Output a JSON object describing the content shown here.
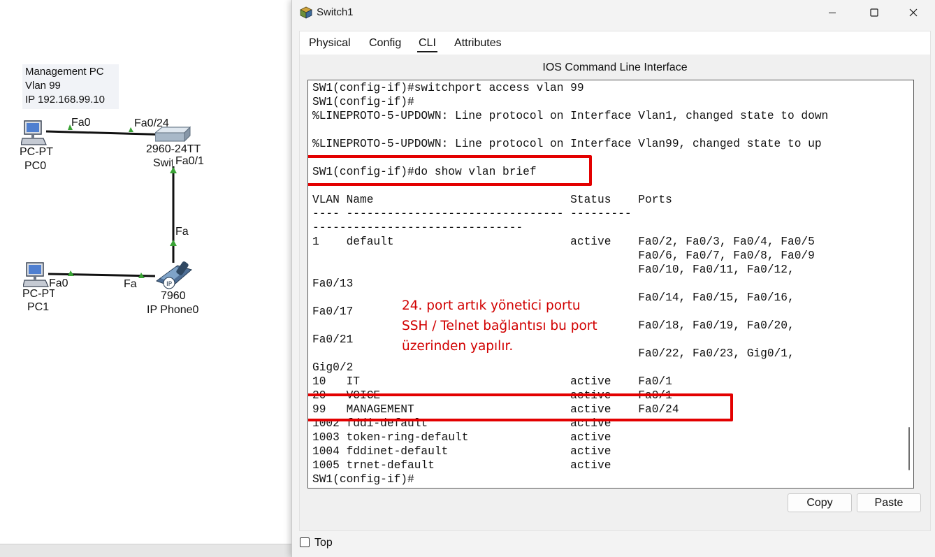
{
  "topology": {
    "note_lines": [
      "Management PC",
      "Vlan 99",
      "IP 192.168.99.10"
    ],
    "pc0": {
      "model": "PC-PT",
      "name": "PC0"
    },
    "pc1": {
      "model": "PC-PT",
      "name": "PC1"
    },
    "switch": {
      "model": "2960-24TT",
      "name": "Switch1"
    },
    "phone": {
      "model": "7960",
      "name": "IP Phone0"
    },
    "port_labels": {
      "pc0_port": "Fa0",
      "switch_fa024": "Fa0/24",
      "switch_fa01": "Fa0/1",
      "phone_up": "Fa",
      "pc1_port": "Fa0",
      "phone_left": "Fa"
    }
  },
  "window": {
    "title": "Switch1",
    "tabs": [
      "Physical",
      "Config",
      "CLI",
      "Attributes"
    ],
    "active_tab": "CLI",
    "cli_header": "IOS Command Line Interface",
    "cli_lines": [
      "SW1(config-if)#switchport access vlan 99",
      "SW1(config-if)#",
      "%LINEPROTO-5-UPDOWN: Line protocol on Interface Vlan1, changed state to down",
      "",
      "%LINEPROTO-5-UPDOWN: Line protocol on Interface Vlan99, changed state to up",
      "",
      "SW1(config-if)#do show vlan brief",
      "",
      "VLAN Name                             Status    Ports",
      "---- -------------------------------- ---------",
      "-------------------------------",
      "1    default                          active    Fa0/2, Fa0/3, Fa0/4, Fa0/5",
      "                                                Fa0/6, Fa0/7, Fa0/8, Fa0/9",
      "                                                Fa0/10, Fa0/11, Fa0/12,",
      "Fa0/13",
      "                                                Fa0/14, Fa0/15, Fa0/16,",
      "Fa0/17",
      "                                                Fa0/18, Fa0/19, Fa0/20,",
      "Fa0/21",
      "                                                Fa0/22, Fa0/23, Gig0/1,",
      "Gig0/2",
      "10   IT                               active    Fa0/1",
      "20   VOICE                            active    Fa0/1",
      "99   MANAGEMENT                       active    Fa0/24",
      "1002 fddi-default                     active",
      "1003 token-ring-default               active",
      "1004 fddinet-default                  active",
      "1005 trnet-default                    active",
      "SW1(config-if)#"
    ],
    "annotation_lines": [
      "24. port artık yönetici portu",
      "SSH / Telnet bağlantısı bu port",
      "üzerinden yapılır."
    ],
    "copy_label": "Copy",
    "paste_label": "Paste",
    "top_label": "Top",
    "top_checked": false
  },
  "colors": {
    "highlight": "#e30000",
    "annotation": "#d10000",
    "link_arrow": "#3aa335"
  }
}
